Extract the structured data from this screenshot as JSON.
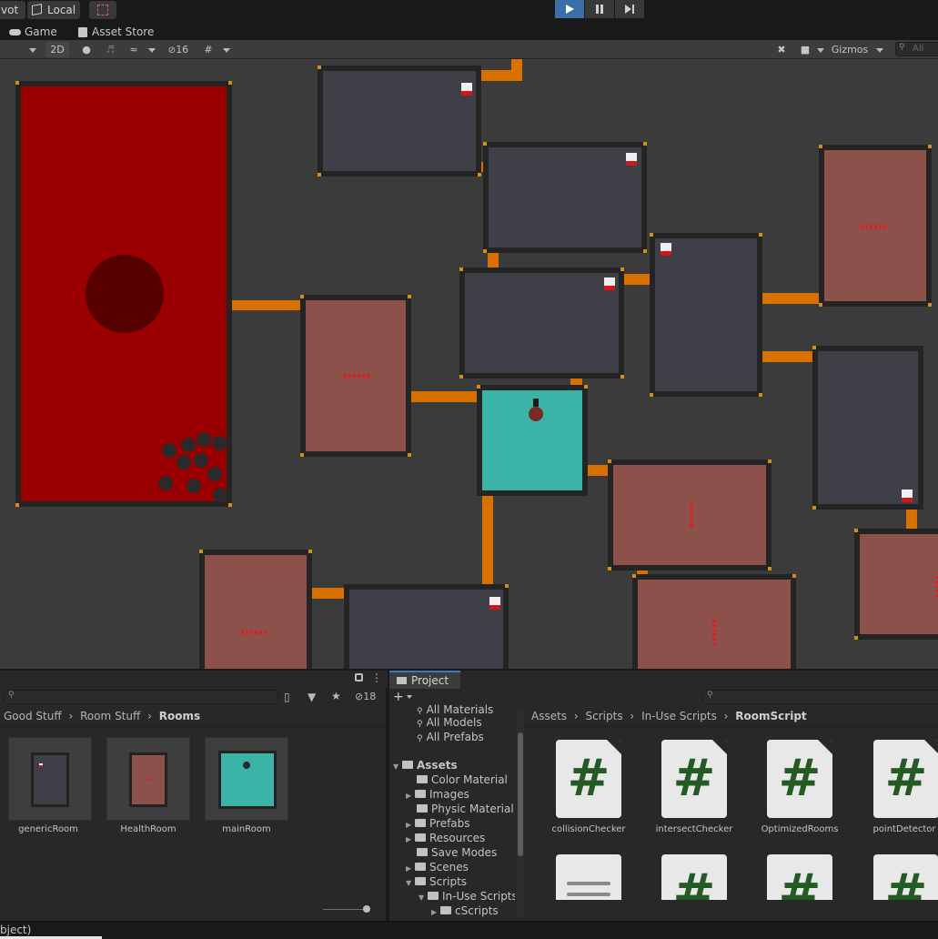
{
  "toolbar": {
    "pivot_label": "vot",
    "local_label": "Local",
    "grid_icon": "grid-snap-icon",
    "play_icon": "play-icon",
    "pause_icon": "pause-icon",
    "step_icon": "step-icon"
  },
  "tabs": [
    {
      "label": "Game",
      "icon": "gamepad-icon"
    },
    {
      "label": "Asset Store",
      "icon": "bag-icon"
    }
  ],
  "scene_toolbar": {
    "mode_2d": "2D",
    "hidden_count": "16",
    "gizmos_label": "Gizmos",
    "search_placeholder": "All"
  },
  "hierarchy": {
    "hidden_count": "18",
    "breadcrumb": [
      "Good Stuff",
      "Room Stuff",
      "Rooms"
    ],
    "assets": [
      {
        "label": "genericRoom"
      },
      {
        "label": "HealthRoom"
      },
      {
        "label": "mainRoom"
      }
    ]
  },
  "project": {
    "tab_label": "Project",
    "favorites": [
      "All Materials",
      "All Models",
      "All Prefabs"
    ],
    "tree": [
      {
        "label": "Assets",
        "bold": true
      },
      {
        "label": "Color Material"
      },
      {
        "label": "Images"
      },
      {
        "label": "Physic Material"
      },
      {
        "label": "Prefabs"
      },
      {
        "label": "Resources"
      },
      {
        "label": "Save Modes"
      },
      {
        "label": "Scenes"
      },
      {
        "label": "Scripts"
      },
      {
        "label": "In-Use Scripts"
      },
      {
        "label": "cScripts"
      }
    ],
    "breadcrumb": [
      "Assets",
      "Scripts",
      "In-Use Scripts",
      "RoomScript"
    ],
    "scripts": [
      {
        "label": "collisionChecker"
      },
      {
        "label": "intersectChecker"
      },
      {
        "label": "OptimizedRooms"
      },
      {
        "label": "pointDetector"
      }
    ]
  },
  "status_bar": {
    "text": "bject)"
  },
  "colors": {
    "lava_room": "#9b0000",
    "health_room": "#8b514a",
    "generic_room": "#3e3f47",
    "main_room": "#3bb3a7",
    "corridor": "#d87100"
  }
}
